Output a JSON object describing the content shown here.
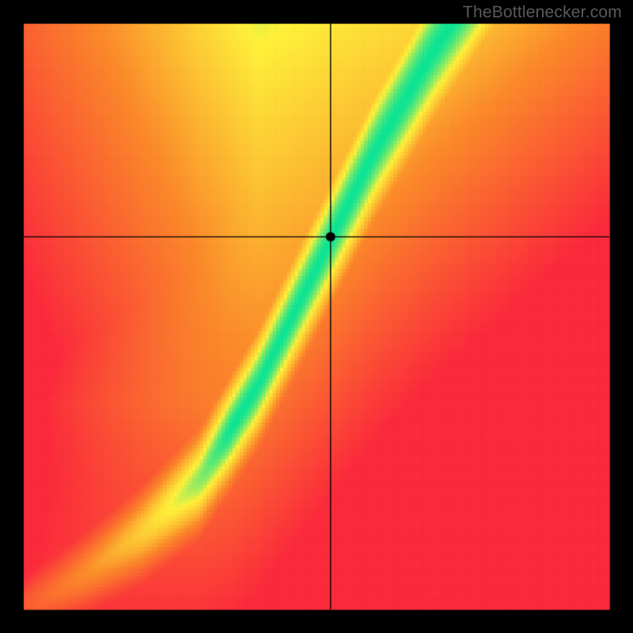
{
  "watermark": "TheBottlenecker.com",
  "chart_data": {
    "type": "heatmap",
    "title": "",
    "xlabel": "",
    "ylabel": "",
    "xlim": [
      0,
      1
    ],
    "ylim": [
      0,
      1
    ],
    "grid_resolution": 160,
    "border_px": 30,
    "canvas_size": 800,
    "crosshair": {
      "x": 0.524,
      "y": 0.636
    },
    "marker": {
      "x": 0.524,
      "y": 0.636,
      "radius_px": 6
    },
    "curve_model": {
      "description": "Ideal GPU/CPU ratio curve; green band along this curve, grading to yellow then orange then red away from it. Upper-right biased toward yellow/orange.",
      "control_points": [
        {
          "x": 0.0,
          "y": 0.0
        },
        {
          "x": 0.1,
          "y": 0.06
        },
        {
          "x": 0.2,
          "y": 0.13
        },
        {
          "x": 0.3,
          "y": 0.22
        },
        {
          "x": 0.4,
          "y": 0.38
        },
        {
          "x": 0.5,
          "y": 0.58
        },
        {
          "x": 0.6,
          "y": 0.78
        },
        {
          "x": 0.7,
          "y": 0.95
        },
        {
          "x": 0.8,
          "y": 1.1
        },
        {
          "x": 0.9,
          "y": 1.25
        },
        {
          "x": 1.0,
          "y": 1.4
        }
      ],
      "green_halfwidth_base": 0.02,
      "green_halfwidth_scale": 0.075,
      "asymmetry_right_bonus": 0.35
    },
    "palette": {
      "red": "#fb2a3c",
      "orange": "#fb8a2a",
      "yellow": "#fef13a",
      "green": "#0be495",
      "black": "#000000"
    }
  }
}
